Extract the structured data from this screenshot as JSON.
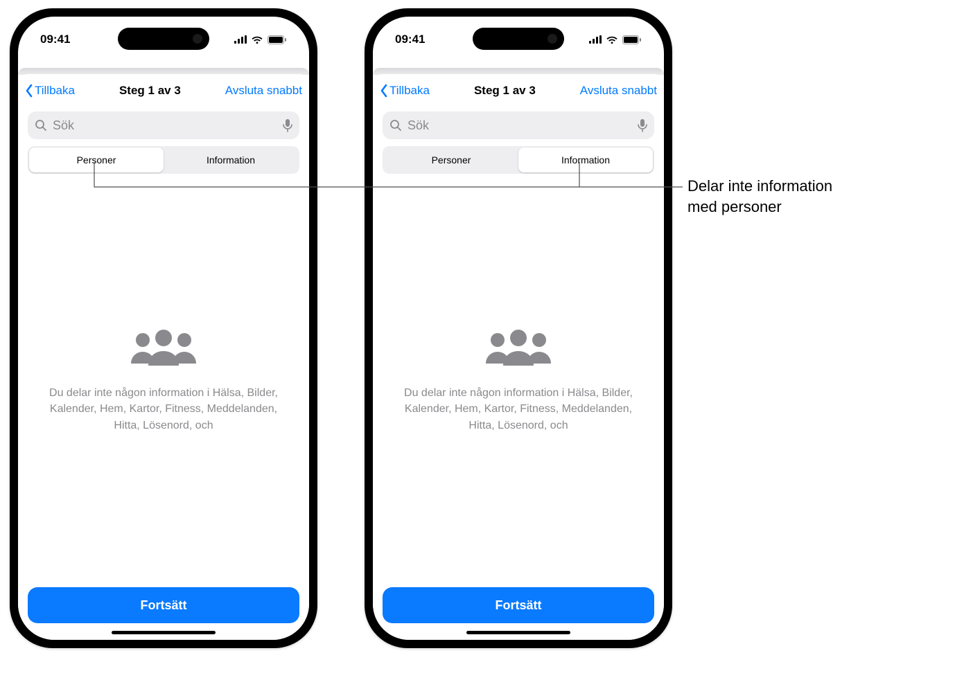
{
  "status": {
    "time": "09:41"
  },
  "nav": {
    "back_label": "Tillbaka",
    "title": "Steg 1 av 3",
    "exit_label": "Avsluta snabbt"
  },
  "search": {
    "placeholder": "Sök"
  },
  "segmented": {
    "personer": "Personer",
    "information": "Information",
    "selected_left": 0,
    "selected_right": 1
  },
  "body": {
    "description": "Du delar inte någon information i Hälsa, Bilder, Kalender, Hem, Kartor, Fitness, Meddelanden, Hitta, Lösenord, och"
  },
  "continue_label": "Fortsätt",
  "callout": {
    "line1": "Delar inte information",
    "line2": "med personer"
  }
}
